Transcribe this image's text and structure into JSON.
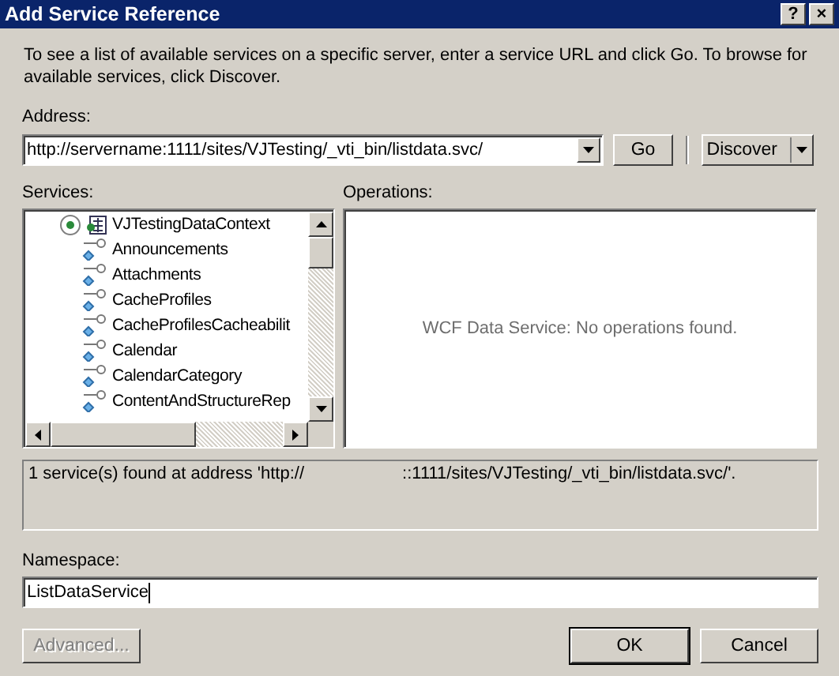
{
  "window": {
    "title": "Add Service Reference",
    "title_buttons": [
      "?",
      "×"
    ]
  },
  "description": "To see a list of available services on a specific server, enter a service URL and click Go. To browse for available services, click Discover.",
  "address": {
    "label": "Address:",
    "value": "http://servername:1111/sites/VJTesting/_vti_bin/listdata.svc/"
  },
  "go_button": "Go",
  "discover_button": "Discover",
  "services": {
    "label": "Services:",
    "tree": [
      {
        "label": "VJTestingDataContext",
        "selected": true,
        "children": [
          {
            "label": "Announcements"
          },
          {
            "label": "Attachments"
          },
          {
            "label": "CacheProfiles"
          },
          {
            "label": "CacheProfilesCacheabilit"
          },
          {
            "label": "Calendar"
          },
          {
            "label": "CalendarCategory"
          },
          {
            "label": "ContentAndStructureRep"
          }
        ]
      }
    ]
  },
  "operations": {
    "label": "Operations:",
    "message": "WCF Data Service: No operations found."
  },
  "status": [
    "1 service(s) found at address 'http://",
    "::1111/sites/VJTesting/_vti_bin/listdata.svc/'."
  ],
  "namespace": {
    "label": "Namespace:",
    "value": "ListDataService"
  },
  "buttons": [
    {
      "label": "Advanced...",
      "disabled": true,
      "default": false
    },
    {
      "label": "OK",
      "disabled": false,
      "default": true
    },
    {
      "label": "Cancel",
      "disabled": false,
      "default": false
    }
  ]
}
